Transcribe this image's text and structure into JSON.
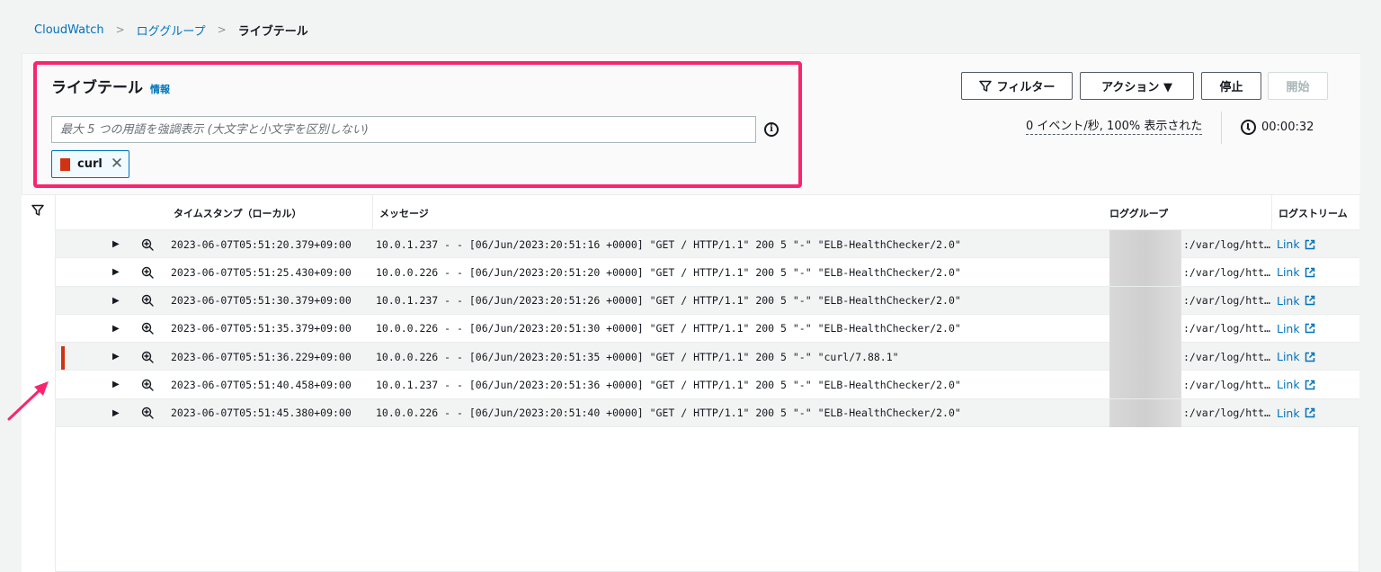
{
  "breadcrumb": {
    "items": [
      "CloudWatch",
      "ロググループ"
    ],
    "current": "ライブテール",
    "separator": ">"
  },
  "header": {
    "title": "ライブテール",
    "info_label": "情報"
  },
  "search": {
    "placeholder": "最大 5 つの用語を強調表示 (大文字と小文字を区別しない)"
  },
  "token": {
    "label": "curl",
    "color": "#d13212"
  },
  "actions": {
    "filter": "フィルター",
    "actions": "アクション ▼",
    "stop": "停止",
    "start": "開始"
  },
  "stats": {
    "rate": "0 イベント/秒, 100% 表示された",
    "elapsed": "00:00:32"
  },
  "table": {
    "headers": {
      "timestamp": "タイムスタンプ（ローカル）",
      "message": "メッセージ",
      "log_group": "ロググループ",
      "log_stream": "ログストリーム"
    },
    "rows": [
      {
        "timestamp": "2023-06-07T05:51:20.379+09:00",
        "message": "10.0.1.237 - - [06/Jun/2023:20:51:16 +0000] \"GET / HTTP/1.1\" 200 5 \"-\" \"ELB-HealthChecker/2.0\"",
        "log_group": ":/var/log/htt…",
        "link": "Link"
      },
      {
        "timestamp": "2023-06-07T05:51:25.430+09:00",
        "message": "10.0.0.226 - - [06/Jun/2023:20:51:20 +0000] \"GET / HTTP/1.1\" 200 5 \"-\" \"ELB-HealthChecker/2.0\"",
        "log_group": ":/var/log/htt…",
        "link": "Link"
      },
      {
        "timestamp": "2023-06-07T05:51:30.379+09:00",
        "message": "10.0.1.237 - - [06/Jun/2023:20:51:26 +0000] \"GET / HTTP/1.1\" 200 5 \"-\" \"ELB-HealthChecker/2.0\"",
        "log_group": ":/var/log/htt…",
        "link": "Link"
      },
      {
        "timestamp": "2023-06-07T05:51:35.379+09:00",
        "message": "10.0.0.226 - - [06/Jun/2023:20:51:30 +0000] \"GET / HTTP/1.1\" 200 5 \"-\" \"ELB-HealthChecker/2.0\"",
        "log_group": ":/var/log/htt…",
        "link": "Link"
      },
      {
        "timestamp": "2023-06-07T05:51:36.229+09:00",
        "message": "10.0.0.226 - - [06/Jun/2023:20:51:35 +0000] \"GET / HTTP/1.1\" 200 5 \"-\" \"curl/7.88.1\"",
        "log_group": ":/var/log/htt…",
        "link": "Link"
      },
      {
        "timestamp": "2023-06-07T05:51:40.458+09:00",
        "message": "10.0.1.237 - - [06/Jun/2023:20:51:36 +0000] \"GET / HTTP/1.1\" 200 5 \"-\" \"ELB-HealthChecker/2.0\"",
        "log_group": ":/var/log/htt…",
        "link": "Link"
      },
      {
        "timestamp": "2023-06-07T05:51:45.380+09:00",
        "message": "10.0.0.226 - - [06/Jun/2023:20:51:40 +0000] \"GET / HTTP/1.1\" 200 5 \"-\" \"ELB-HealthChecker/2.0\"",
        "log_group": ":/var/log/htt…",
        "link": "Link"
      }
    ],
    "highlighted_row": 4
  },
  "colors": {
    "link": "#0073bb",
    "highlight_box": "#f8256f",
    "match_marker": "#d13212"
  },
  "icons": {
    "filter": "filter-icon",
    "info": "info-icon",
    "clock": "clock-icon",
    "expand": "caret-right-icon",
    "zoom": "zoom-in-icon",
    "external": "external-link-icon",
    "annotation": "arrow-annotation-icon"
  }
}
